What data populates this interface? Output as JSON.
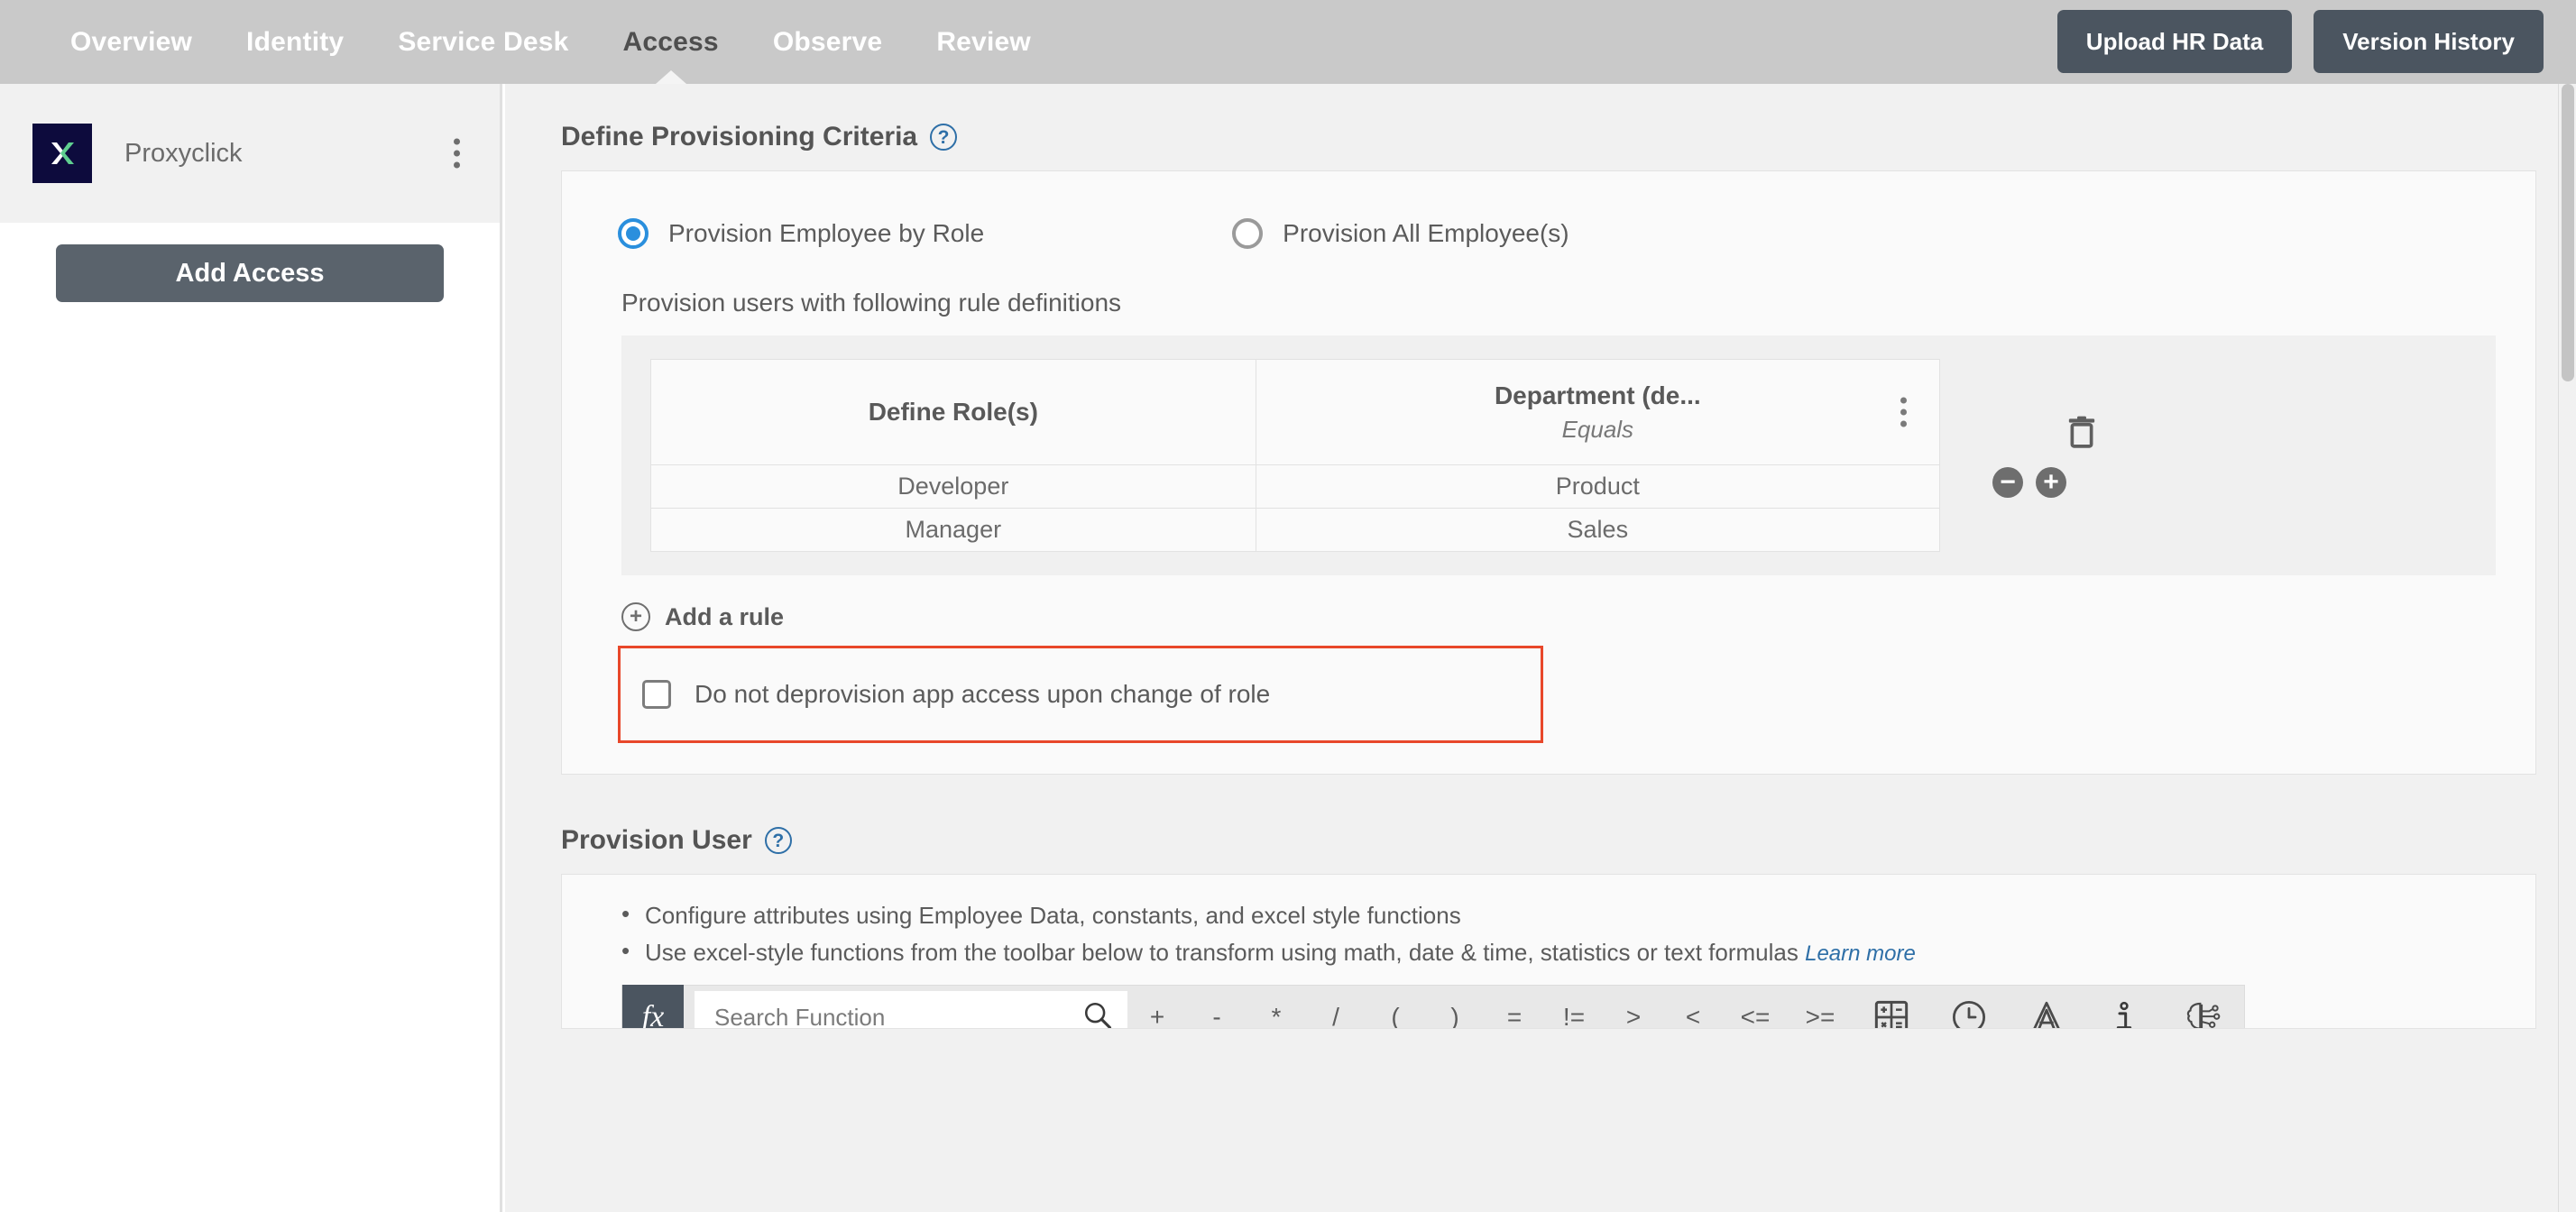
{
  "topnav": {
    "items": [
      {
        "label": "Overview",
        "active": false
      },
      {
        "label": "Identity",
        "active": false
      },
      {
        "label": "Service Desk",
        "active": false
      },
      {
        "label": "Access",
        "active": true
      },
      {
        "label": "Observe",
        "active": false
      },
      {
        "label": "Review",
        "active": false
      }
    ],
    "upload_button": "Upload HR Data",
    "version_button": "Version History",
    "bg_color": "#c9c9c9",
    "button_color": "#4b5560"
  },
  "sidebar": {
    "app_name": "Proxyclick",
    "logo_bg": "#0d0b3d",
    "logo_accent": "#5fcf90",
    "add_access_label": "Add Access",
    "kebab_name": "app-options-menu"
  },
  "criteria": {
    "title": "Define Provisioning Criteria",
    "help_label": "?",
    "radios": [
      {
        "label": "Provision Employee by Role",
        "selected": true
      },
      {
        "label": "Provision All Employee(s)",
        "selected": false
      }
    ],
    "rule_intro": "Provision users with following rule definitions",
    "table": {
      "columns": [
        {
          "header": "Define Role(s)",
          "sub": ""
        },
        {
          "header": "Department (de...",
          "sub": "Equals"
        }
      ],
      "rows": [
        {
          "role": "Developer",
          "department": "Product"
        },
        {
          "role": "Manager",
          "department": "Sales"
        }
      ]
    },
    "remove_row_label": "−",
    "add_row_label": "+",
    "add_rule_label": "Add a rule",
    "add_rule_icon": "+",
    "checkbox": {
      "label": "Do not deprovision app access upon change of role",
      "checked": false,
      "highlight_color": "#e8472a"
    }
  },
  "provision_user": {
    "title": "Provision User",
    "help_label": "?",
    "bullets": [
      "Configure attributes using Employee Data, constants, and excel style functions",
      "Use excel-style functions from the toolbar below to transform using math, date & time, statistics or text formulas"
    ],
    "learn_more": "Learn more",
    "toolbar": {
      "fx_label": "fx",
      "search_placeholder": "Search Function",
      "search_value": "",
      "operators": [
        "+",
        "-",
        "*",
        "/",
        "(",
        ")",
        "=",
        "!=",
        ">",
        "<",
        "<=",
        ">="
      ],
      "icons": [
        {
          "name": "math-functions-icon"
        },
        {
          "name": "clock-icon"
        },
        {
          "name": "text-functions-icon"
        },
        {
          "name": "info-icon"
        },
        {
          "name": "ai-brain-icon"
        }
      ]
    }
  }
}
